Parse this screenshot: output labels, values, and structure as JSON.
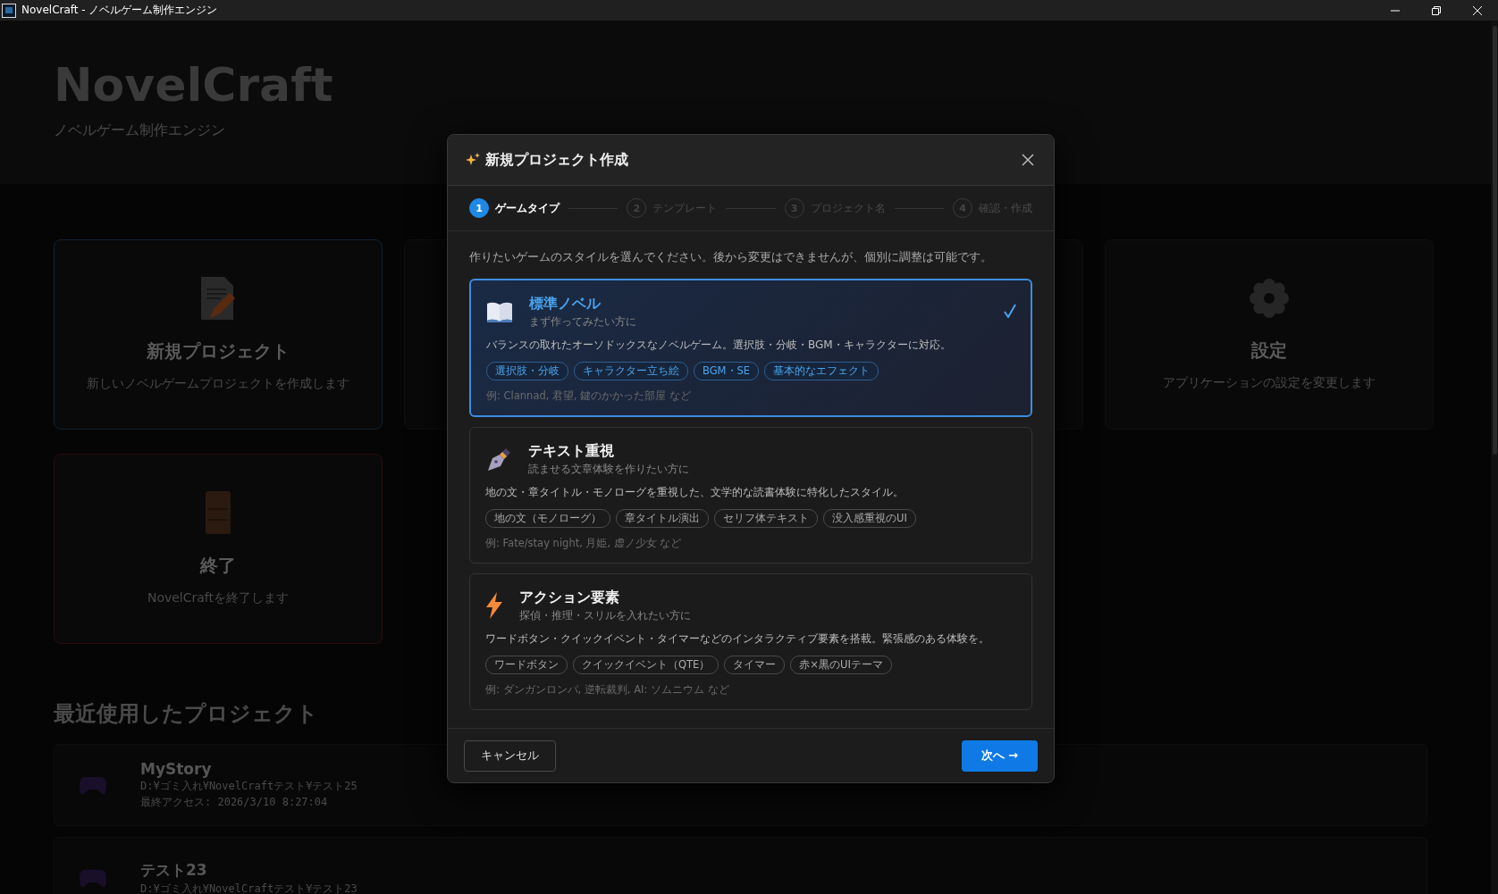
{
  "window": {
    "title": "NovelCraft - ノベルゲーム制作エンジン"
  },
  "app_header": {
    "title": "NovelCraft",
    "subtitle": "ノベルゲーム制作エンジン"
  },
  "home_cards": [
    {
      "kind": "new",
      "title": "新規プロジェクト",
      "description": "新しいノベルゲームプロジェクトを作成します"
    },
    {
      "kind": "settings",
      "title": "設定",
      "description": "アプリケーションの設定を変更します"
    },
    {
      "kind": "exit",
      "title": "終了",
      "description": "NovelCraftを終了します"
    }
  ],
  "recent": {
    "heading": "最近使用したプロジェクト",
    "projects": [
      {
        "name": "MyStory",
        "path": "D:¥ゴミ入れ¥NovelCraftテスト¥テスト25",
        "last_access": "最終アクセス: 2026/3/10 8:27:04"
      },
      {
        "name": "テスト23",
        "path": "D:¥ゴミ入れ¥NovelCraftテスト¥テスト23"
      }
    ]
  },
  "dialog": {
    "title": "新規プロジェクト作成",
    "steps": [
      {
        "number": "1",
        "label": "ゲームタイプ",
        "selected": true
      },
      {
        "number": "2",
        "label": "テンプレート",
        "selected": false
      },
      {
        "number": "3",
        "label": "プロジェクト名",
        "selected": false
      },
      {
        "number": "4",
        "label": "確認・作成",
        "selected": false
      }
    ],
    "instruction": "作りたいゲームのスタイルを選んでください。後から変更はできませんが、個別に調整は可能です。",
    "game_types": [
      {
        "kind": "book",
        "title": "標準ノベル",
        "subtitle": "まず作ってみたい方に",
        "description": "バランスの取れたオーソドックスなノベルゲーム。選択肢・分岐・BGM・キャラクターに対応。",
        "tags": [
          "選択肢・分岐",
          "キャラクター立ち絵",
          "BGM・SE",
          "基本的なエフェクト"
        ],
        "examples": "例: Clannad, 君望, 鍵のかかった部屋 など",
        "selected": true
      },
      {
        "kind": "pen",
        "title": "テキスト重視",
        "subtitle": "読ませる文章体験を作りたい方に",
        "description": "地の文・章タイトル・モノローグを重視した、文学的な読書体験に特化したスタイル。",
        "tags": [
          "地の文（モノローグ）",
          "章タイトル演出",
          "セリフ体テキスト",
          "没入感重視のUI"
        ],
        "examples": "例: Fate/stay night, 月姫, 虚ノ少女 など",
        "selected": false
      },
      {
        "kind": "bolt",
        "title": "アクション要素",
        "subtitle": "探偵・推理・スリルを入れたい方に",
        "description": "ワードボタン・クイックイベント・タイマーなどのインタラクティブ要素を搭載。緊張感のある体験を。",
        "tags": [
          "ワードボタン",
          "クイックイベント（QTE）",
          "タイマー",
          "赤×黒のUIテーマ"
        ],
        "examples": "例: ダンガンロンパ, 逆転裁判, AI: ソムニウム など",
        "selected": false
      }
    ],
    "buttons": {
      "cancel": "キャンセル",
      "next": "次へ →"
    }
  }
}
